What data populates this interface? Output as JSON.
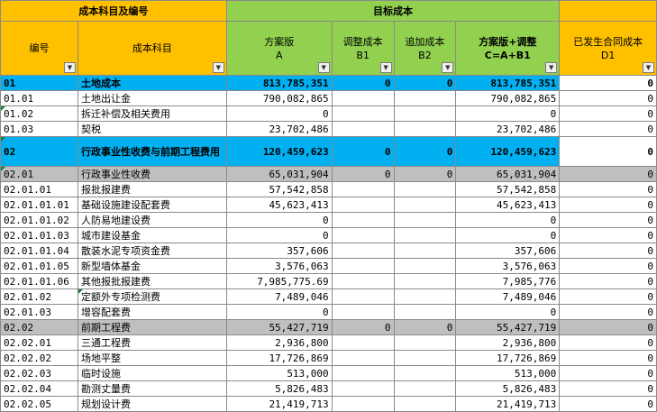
{
  "header": {
    "group_code": "成本科目及编号",
    "group_target": "目标成本",
    "col_code": "编号",
    "col_name": "成本科目",
    "col_a": "方案版\nA",
    "col_b1": "调整成本\nB1",
    "col_b2": "追加成本\nB2",
    "col_c": "方案版+调整\nC=A+B1",
    "col_d1": "已发生合同成本\nD1",
    "filter_icon": "▼"
  },
  "colors": {
    "yellow": "#ffc000",
    "green": "#92d050",
    "cyan": "#00b0f0",
    "gray": "#bfbfbf"
  },
  "rows": [
    {
      "code": "01",
      "name": "土地成本",
      "a": "813,785,351",
      "b1": "0",
      "b2": "0",
      "c": "813,785,351",
      "d1": "0"
    },
    {
      "code": "01.01",
      "name": "土地出让金",
      "a": "790,082,865",
      "b1": "",
      "b2": "",
      "c": "790,082,865",
      "d1": "0"
    },
    {
      "code": "01.02",
      "name": "拆迁补偿及相关费用",
      "a": "0",
      "b1": "",
      "b2": "",
      "c": "0",
      "d1": "0"
    },
    {
      "code": "01.03",
      "name": "契税",
      "a": "23,702,486",
      "b1": "",
      "b2": "",
      "c": "23,702,486",
      "d1": "0"
    },
    {
      "code": "02",
      "name": "行政事业性收费与前期工程费用",
      "a": "120,459,623",
      "b1": "0",
      "b2": "0",
      "c": "120,459,623",
      "d1": "0"
    },
    {
      "code": "02.01",
      "name": "行政事业性收费",
      "a": "65,031,904",
      "b1": "0",
      "b2": "0",
      "c": "65,031,904",
      "d1": "0"
    },
    {
      "code": "02.01.01",
      "name": "报批报建费",
      "a": "57,542,858",
      "b1": "",
      "b2": "",
      "c": "57,542,858",
      "d1": "0"
    },
    {
      "code": "02.01.01.01",
      "name": "基础设施建设配套费",
      "a": "45,623,413",
      "b1": "",
      "b2": "",
      "c": "45,623,413",
      "d1": "0"
    },
    {
      "code": "02.01.01.02",
      "name": "人防易地建设费",
      "a": "0",
      "b1": "",
      "b2": "",
      "c": "0",
      "d1": "0"
    },
    {
      "code": "02.01.01.03",
      "name": "城市建设基金",
      "a": "0",
      "b1": "",
      "b2": "",
      "c": "0",
      "d1": "0"
    },
    {
      "code": "02.01.01.04",
      "name": "散装水泥专项资金费",
      "a": "357,606",
      "b1": "",
      "b2": "",
      "c": "357,606",
      "d1": "0"
    },
    {
      "code": "02.01.01.05",
      "name": "新型墙体基金",
      "a": "3,576,063",
      "b1": "",
      "b2": "",
      "c": "3,576,063",
      "d1": "0"
    },
    {
      "code": "02.01.01.06",
      "name": "其他报批报建费",
      "a": "7,985,775.69",
      "b1": "",
      "b2": "",
      "c": "7,985,776",
      "d1": "0"
    },
    {
      "code": "02.01.02",
      "name": "定额外专项检测费",
      "a": "7,489,046",
      "b1": "",
      "b2": "",
      "c": "7,489,046",
      "d1": "0"
    },
    {
      "code": "02.01.03",
      "name": "增容配套费",
      "a": "0",
      "b1": "",
      "b2": "",
      "c": "0",
      "d1": "0"
    },
    {
      "code": "02.02",
      "name": "前期工程费",
      "a": "55,427,719",
      "b1": "0",
      "b2": "0",
      "c": "55,427,719",
      "d1": "0"
    },
    {
      "code": "02.02.01",
      "name": "三通工程费",
      "a": "2,936,800",
      "b1": "",
      "b2": "",
      "c": "2,936,800",
      "d1": "0"
    },
    {
      "code": "02.02.02",
      "name": "场地平整",
      "a": "17,726,869",
      "b1": "",
      "b2": "",
      "c": "17,726,869",
      "d1": "0"
    },
    {
      "code": "02.02.03",
      "name": "临时设施",
      "a": "513,000",
      "b1": "",
      "b2": "",
      "c": "513,000",
      "d1": "0"
    },
    {
      "code": "02.02.04",
      "name": "勘测丈量费",
      "a": "5,826,483",
      "b1": "",
      "b2": "",
      "c": "5,826,483",
      "d1": "0"
    },
    {
      "code": "02.02.05",
      "name": "规划设计费",
      "a": "21,419,713",
      "b1": "",
      "b2": "",
      "c": "21,419,713",
      "d1": "0"
    }
  ]
}
